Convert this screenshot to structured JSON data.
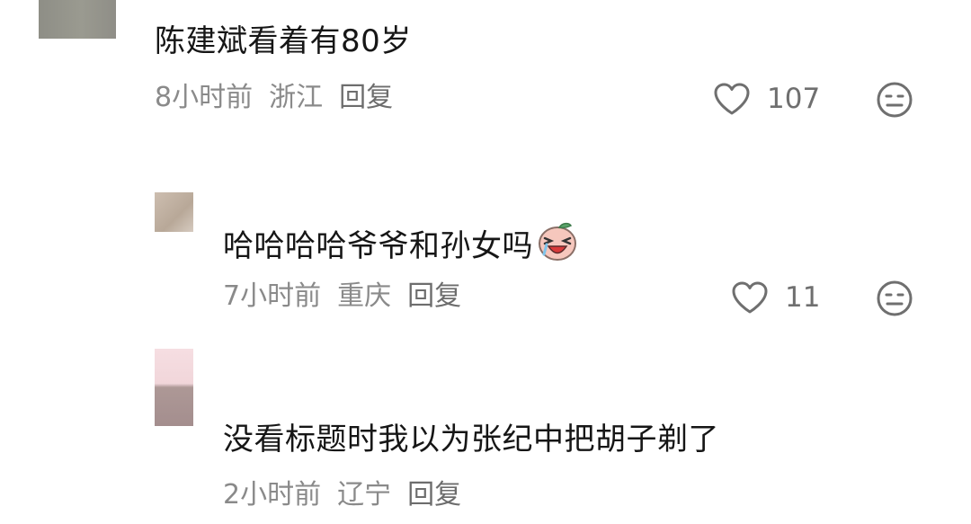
{
  "comments": [
    {
      "text": "陈建斌看着有80岁",
      "time": "8小时前",
      "location": "浙江",
      "reply_label": "回复",
      "likes": "107"
    },
    {
      "text": "哈哈哈哈爷爷和孙女吗",
      "emoji": "laughing-crying-peach-emoji",
      "time": "7小时前",
      "location": "重庆",
      "reply_label": "回复",
      "likes": "11"
    },
    {
      "text": "没看标题时我以为张纪中把胡子剃了",
      "time": "2小时前",
      "location": "辽宁",
      "reply_label": "回复"
    }
  ],
  "icons": {
    "like": "heart-outline-icon",
    "dislike": "meh-face-icon"
  },
  "colors": {
    "text": "#161616",
    "meta": "#8a8a8a",
    "icon": "#6f6f6f"
  }
}
